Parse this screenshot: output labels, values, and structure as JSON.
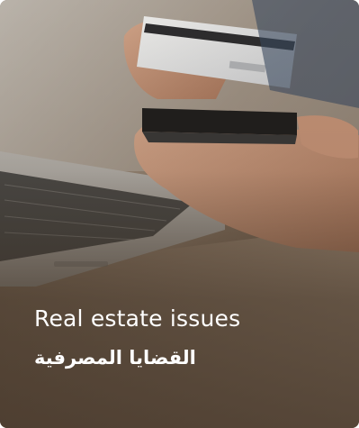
{
  "card": {
    "title_en": "Real estate issues",
    "title_ar": "القضايا المصرفية",
    "image_subject": "hands holding a credit card and a smartphone above a laptop keyboard"
  },
  "colors": {
    "text": "#ffffff",
    "overlay": "#3c2e22"
  }
}
